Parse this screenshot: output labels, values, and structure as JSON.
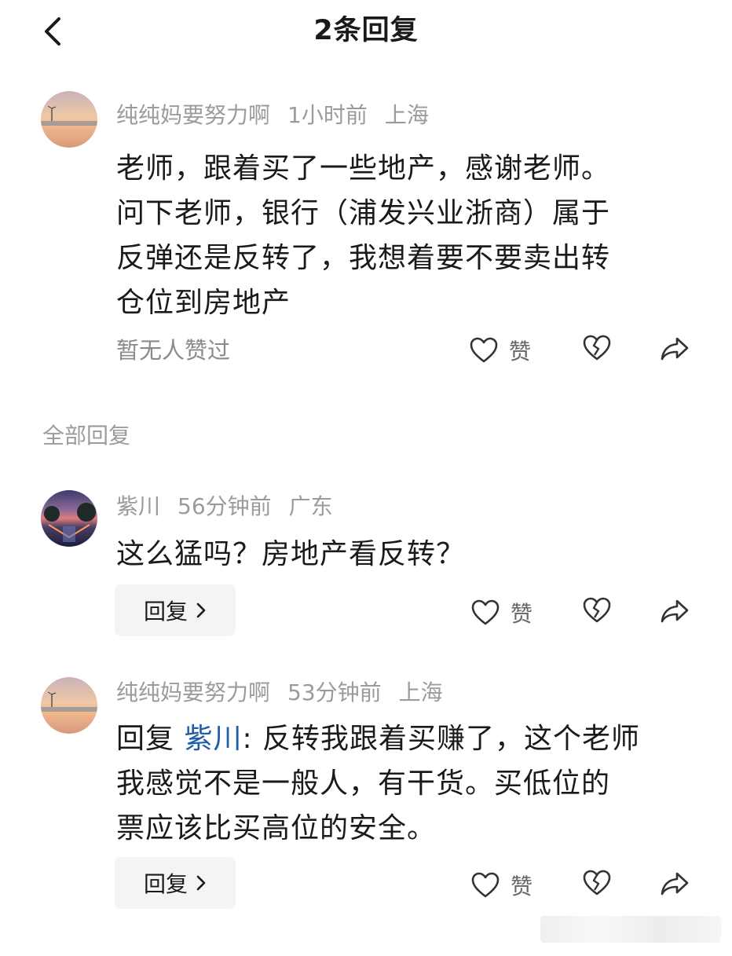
{
  "header": {
    "title": "2条回复"
  },
  "main_comment": {
    "author": "纯纯妈要努力啊",
    "time": "1小时前",
    "location": "上海",
    "text_lines": [
      "老师，跟着买了一些地产，感谢老师。",
      "问下老师，银行（浦发兴业浙商）属于",
      "反弹还是反转了，我想着要不要卖出转",
      "仓位到房地产"
    ],
    "likes_status": "暂无人赞过",
    "like_label": "赞"
  },
  "section": {
    "title": "全部回复"
  },
  "replies": [
    {
      "author": "紫川",
      "time": "56分钟前",
      "location": "广东",
      "text": "这么猛吗？房地产看反转？",
      "reply_button": "回复",
      "like_label": "赞"
    },
    {
      "author": "纯纯妈要努力啊",
      "time": "53分钟前",
      "location": "上海",
      "reply_prefix": "回复",
      "mention": "紫川",
      "text_lines": [
        ": 反转我跟着买赚了，这个老师",
        "我感觉不是一般人，有干货。买低位的",
        "票应该比买高位的安全。"
      ],
      "reply_button": "回复",
      "like_label": "赞"
    }
  ],
  "icons": {
    "back": "back-arrow-icon",
    "like": "heart-icon",
    "dislike": "broken-heart-icon",
    "share": "share-icon",
    "chevron": "chevron-right-icon"
  },
  "colors": {
    "mention": "#1f5fa8",
    "meta": "#9b9b9b"
  }
}
